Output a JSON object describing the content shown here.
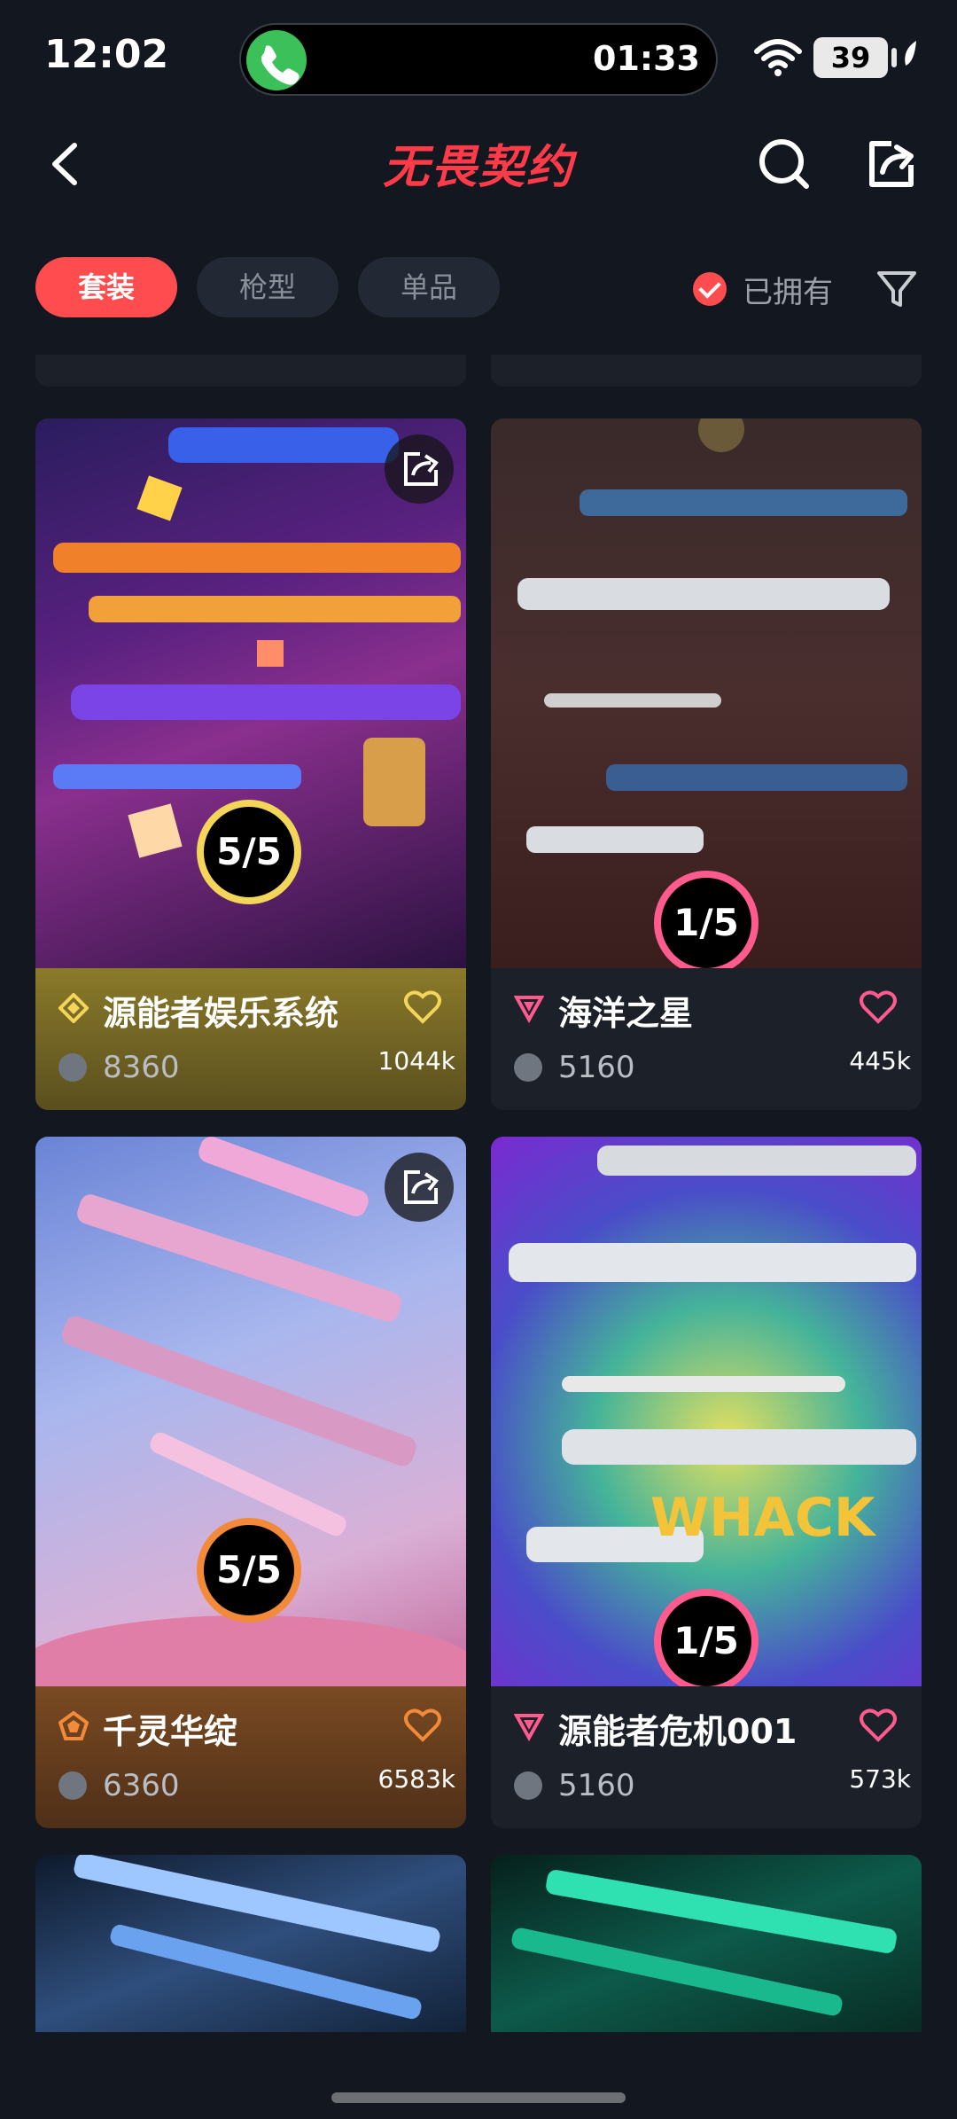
{
  "status": {
    "time": "12:02",
    "call_timer": "01:33",
    "battery": "39"
  },
  "header": {
    "title": "无畏契约"
  },
  "filters": {
    "tabs": [
      {
        "label": "套装",
        "active": true
      },
      {
        "label": "枪型",
        "active": false
      },
      {
        "label": "单品",
        "active": false
      }
    ],
    "owned_label": "已拥有"
  },
  "cards": [
    {
      "name": "源能者娱乐系统",
      "price": "8360",
      "likes": "1044k",
      "progress": "5/5",
      "tier": "gold"
    },
    {
      "name": "海洋之星",
      "price": "5160",
      "likes": "445k",
      "progress": "1/5",
      "tier": "pink"
    },
    {
      "name": "千灵华绽",
      "price": "6360",
      "likes": "6583k",
      "progress": "5/5",
      "tier": "orange"
    },
    {
      "name": "源能者危机001",
      "price": "5160",
      "likes": "573k",
      "progress": "1/5",
      "tier": "pink"
    }
  ],
  "colors": {
    "accent": "#ff4d4f",
    "gold": "#f3d55a",
    "orange": "#f28a3a",
    "pink": "#ff5b8f",
    "bg": "#13171f"
  },
  "icons": [
    "back-icon",
    "search-icon",
    "share-icon",
    "filter-icon",
    "heart-icon",
    "coin-icon"
  ]
}
